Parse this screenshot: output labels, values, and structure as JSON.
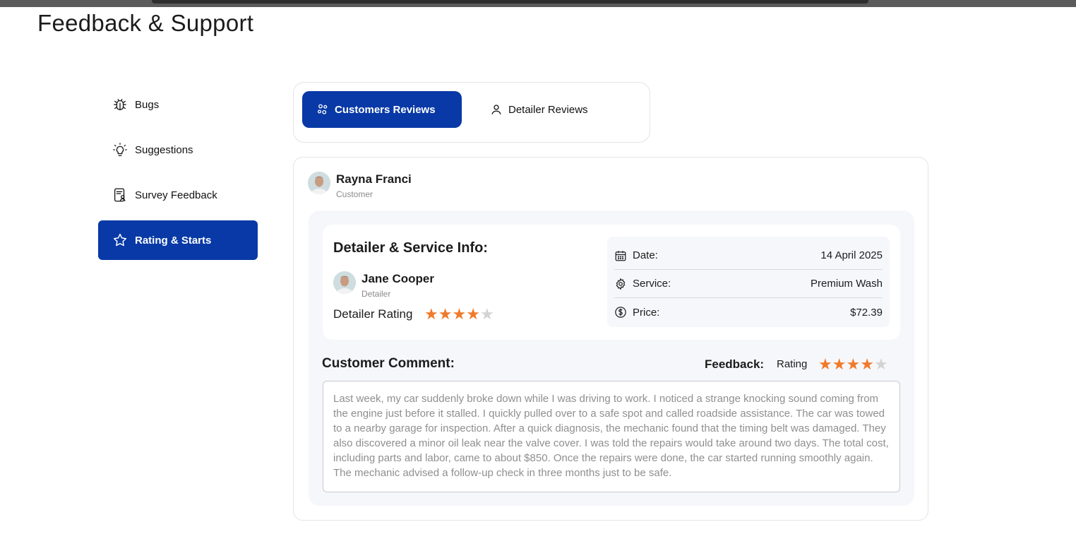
{
  "page": {
    "title": "Feedback & Support"
  },
  "sidebar": {
    "items": [
      {
        "label": "Bugs",
        "icon": "bug-icon",
        "active": false
      },
      {
        "label": "Suggestions",
        "icon": "lightbulb-icon",
        "active": false
      },
      {
        "label": "Survey Feedback",
        "icon": "survey-icon",
        "active": false
      },
      {
        "label": "Rating & Starts",
        "icon": "star-icon",
        "active": true
      }
    ]
  },
  "tabs": {
    "items": [
      {
        "label": "Customers Reviews",
        "icon": "users-icon",
        "active": true
      },
      {
        "label": "Detailer Reviews",
        "icon": "user-icon",
        "active": false
      }
    ]
  },
  "review": {
    "reviewer": {
      "name": "Rayna Franci",
      "role": "Customer"
    },
    "info_title": "Detailer & Service Info:",
    "detailer": {
      "name": "Jane Cooper",
      "role": "Detailer"
    },
    "detailer_rating_label": "Detailer Rating",
    "detailer_rating": 4,
    "details": {
      "date_label": "Date:",
      "date_value": "14 April 2025",
      "service_label": "Service:",
      "service_value": "Premium Wash",
      "price_label": "Price:",
      "price_value": "$72.39"
    },
    "comment_title": "Customer Comment:",
    "feedback_label": "Feedback:",
    "rating_label": "Rating",
    "feedback_rating": 4,
    "comment": "Last week, my car suddenly broke down while I was driving to work. I noticed a strange knocking sound coming from the engine just before it stalled. I quickly pulled over to a safe spot and called roadside assistance. The car was towed to a nearby garage for inspection. After a quick diagnosis, the mechanic found that the timing belt was damaged. They also discovered a minor oil leak near the valve cover. I was told the repairs would take around two days. The total cost, including parts and labor, came to about $850. Once the repairs were done, the car started running smoothly again. The mechanic advised a follow-up check in three months just to be safe."
  },
  "colors": {
    "primary": "#0839a6",
    "star_filled": "#f07a2b",
    "star_empty": "#d3d3d3"
  }
}
